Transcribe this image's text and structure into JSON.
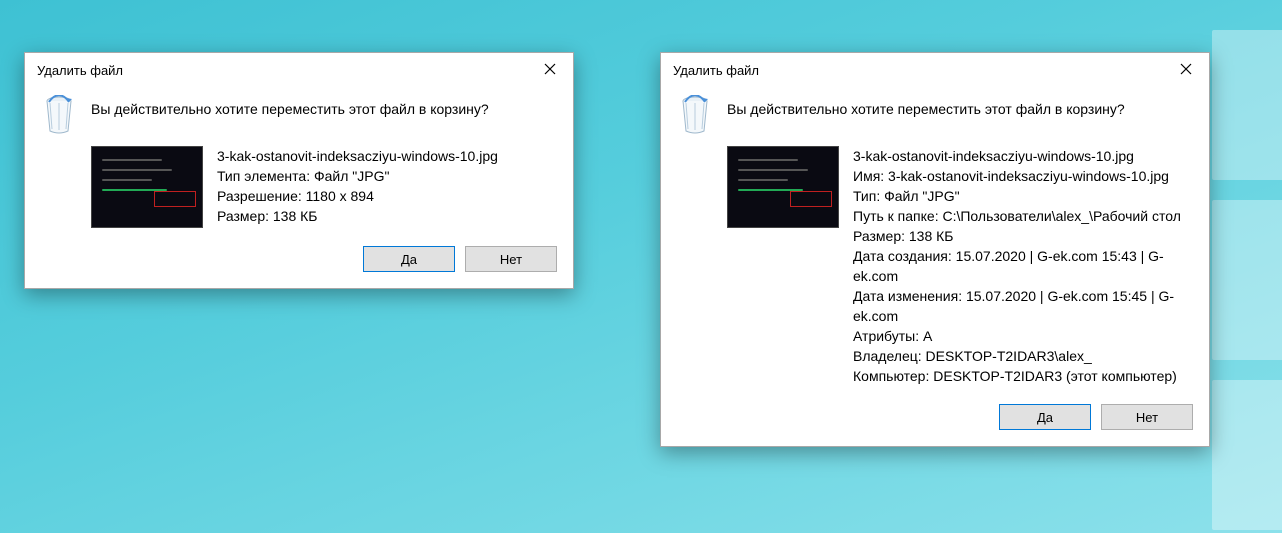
{
  "dialog_left": {
    "title": "Удалить файл",
    "prompt": "Вы действительно хотите переместить этот файл в корзину?",
    "details": [
      "3-kak-ostanovit-indeksacziyu-windows-10.jpg",
      "Тип элемента: Файл \"JPG\"",
      "Разрешение: 1180 x 894",
      "Размер: 138 КБ"
    ],
    "yes": "Да",
    "no": "Нет"
  },
  "dialog_right": {
    "title": "Удалить файл",
    "prompt": "Вы действительно хотите переместить этот файл в корзину?",
    "details": [
      "3-kak-ostanovit-indeksacziyu-windows-10.jpg",
      "Имя: 3-kak-ostanovit-indeksacziyu-windows-10.jpg",
      "Тип: Файл \"JPG\"",
      "Путь к папке: C:\\Пользователи\\alex_\\Рабочий стол",
      "Размер: 138 КБ",
      "Дата создания: 15.07.2020 | G-ek.com 15:43 | G-ek.com",
      "Дата изменения: 15.07.2020 | G-ek.com 15:45 | G-ek.com",
      "Атрибуты: A",
      "Владелец: DESKTOP-T2IDAR3\\alex_",
      "Компьютер: DESKTOP-T2IDAR3 (этот компьютер)"
    ],
    "yes": "Да",
    "no": "Нет"
  }
}
